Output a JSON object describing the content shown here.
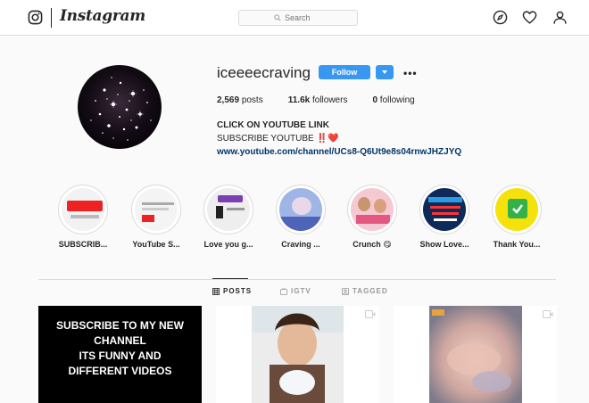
{
  "nav": {
    "wordmark": "Instagram",
    "search_placeholder": "Search",
    "icons": [
      "instagram-glyph-icon",
      "compass-icon",
      "heart-icon",
      "user-icon"
    ]
  },
  "profile": {
    "username": "iceeeecraving",
    "follow_label": "Follow",
    "posts_count": "2,569",
    "posts_label": "posts",
    "followers_count": "11.6k",
    "followers_label": "followers",
    "following_count": "0",
    "following_label": "following",
    "bio_name": "CLICK ON YOUTUBE LINK",
    "bio_line": "SUBSCRIBE YOUTUBE ‼️❤️",
    "bio_link": "www.youtube.com/channel/UCs8-Q6Ut9e8s04rnwJHZJYQ"
  },
  "highlights": [
    {
      "label": "SUBSCRIB...",
      "color": "#f2f2f2"
    },
    {
      "label": "YouTube S...",
      "color": "#f4f4f4"
    },
    {
      "label": "Love you g...",
      "color": "#eeeeee"
    },
    {
      "label": "Craving ...",
      "color": "#9fb5e6"
    },
    {
      "label": "Crunch 😋",
      "color": "#f5c9d2"
    },
    {
      "label": "Show Love...",
      "color": "#0d2a58"
    },
    {
      "label": "Thank You...",
      "color": "#f5e20c"
    }
  ],
  "tabs": [
    {
      "label": "POSTS",
      "active": true
    },
    {
      "label": "IGTV",
      "active": false
    },
    {
      "label": "TAGGED",
      "active": false
    }
  ],
  "posts": [
    {
      "text_lines": [
        "SUBSCRIBE TO MY NEW",
        "CHANNEL",
        "ITS FUNNY AND",
        "DIFFERENT VIDEOS"
      ]
    },
    {
      "text_lines": []
    },
    {
      "text_lines": []
    }
  ],
  "colors": {
    "accent": "#3897f0",
    "link": "#003569",
    "border": "#dbdbdb",
    "background": "#fafafa"
  }
}
